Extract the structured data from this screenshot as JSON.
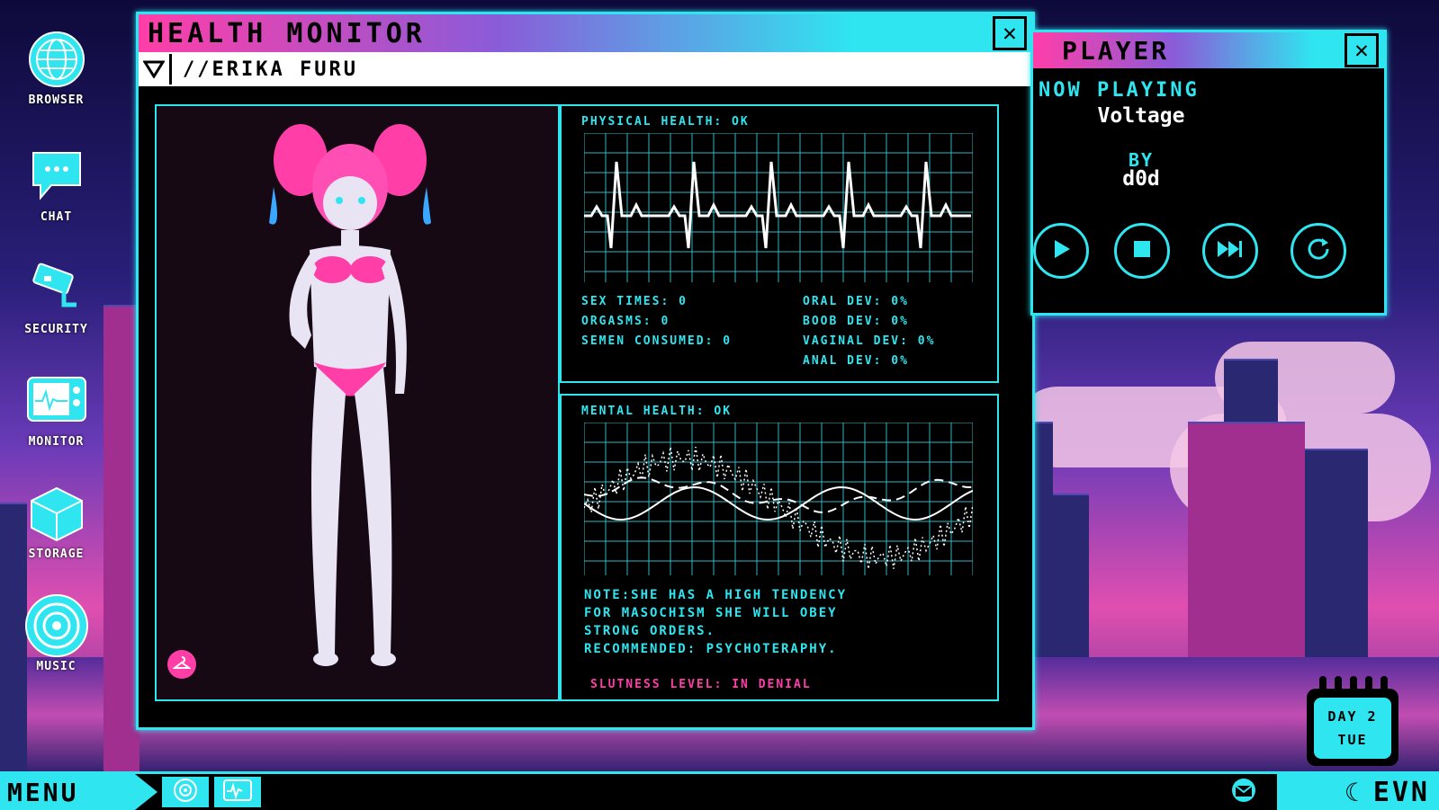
{
  "desktop": {
    "icons": [
      {
        "label": "BROWSER",
        "icon": "globe-icon"
      },
      {
        "label": "CHAT",
        "icon": "chat-bubble-icon"
      },
      {
        "label": "SECURITY",
        "icon": "security-camera-icon"
      },
      {
        "label": "MONITOR",
        "icon": "monitor-icon"
      },
      {
        "label": "STORAGE",
        "icon": "box-icon"
      },
      {
        "label": "MUSIC",
        "icon": "disc-icon"
      }
    ]
  },
  "health_monitor": {
    "title": "HEALTH MONITOR",
    "subject": "//ERIKA FURU",
    "physical": {
      "heading": "PHYSICAL HEALTH: OK",
      "stats_left": [
        "SEX TIMES: 0",
        "ORGASMS: 0",
        "SEMEN CONSUMED: 0"
      ],
      "stats_right": [
        "ORAL DEV: 0%",
        "BOOB DEV: 0%",
        "VAGINAL DEV: 0%",
        "ANAL DEV: 0%"
      ]
    },
    "mental": {
      "heading": "MENTAL HEALTH: OK",
      "note_lines": [
        "NOTE:SHE HAS A HIGH TENDENCY",
        "FOR MASOCHISM SHE WILL OBEY",
        "STRONG ORDERS.",
        "RECOMMENDED: PSYCHOTERAPHY."
      ],
      "slutness": "SLUTNESS LEVEL: IN DENIAL"
    }
  },
  "player": {
    "title": "PLAYER",
    "now_playing_label": "NOW PLAYING",
    "track": "Voltage",
    "by_label": "BY",
    "artist": "d0d"
  },
  "taskbar": {
    "menu_label": "MENU",
    "time_of_day": "EVN"
  },
  "calendar": {
    "day": "DAY 2",
    "weekday": "TUE"
  },
  "colors": {
    "accent": "#2fe5f0",
    "pink": "#ff3ea8"
  }
}
